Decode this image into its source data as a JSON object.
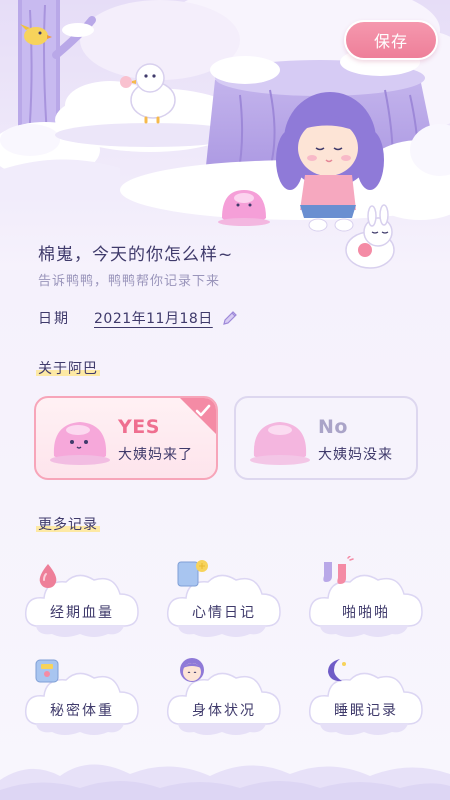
{
  "header": {
    "save_label": "保存"
  },
  "intro": {
    "greeting": "棉嵬，今天的你怎么样~",
    "subtitle": "告诉鸭鸭，鸭鸭帮你记录下来"
  },
  "date": {
    "label": "日期",
    "value": "2021年11月18日"
  },
  "period": {
    "section_title": "关于阿巴",
    "yes": {
      "title": "YES",
      "desc": "大姨妈来了",
      "selected": true
    },
    "no": {
      "title": "No",
      "desc": "大姨妈没来",
      "selected": false
    }
  },
  "more": {
    "section_title": "更多记录",
    "items": [
      {
        "label": "经期血量",
        "icon": "blood-drop-icon"
      },
      {
        "label": "心情日记",
        "icon": "diary-icon"
      },
      {
        "label": "啪啪啪",
        "icon": "socks-icon"
      },
      {
        "label": "秘密体重",
        "icon": "scale-icon"
      },
      {
        "label": "身体状况",
        "icon": "girl-face-icon"
      },
      {
        "label": "睡眠记录",
        "icon": "moon-icon"
      }
    ]
  },
  "colors": {
    "accent_pink": "#ee7f99",
    "text_primary": "#3f3a6b",
    "text_secondary": "#9a95bb",
    "cloud_fill": "#ffffff",
    "cloud_shadow": "#dcd6f3"
  }
}
